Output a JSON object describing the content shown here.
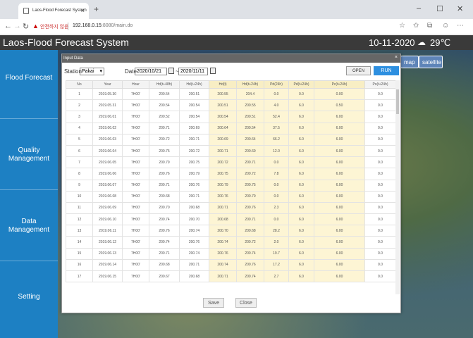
{
  "browser": {
    "tab_title": "Laos-Flood Forecast System",
    "tab_close": "×",
    "new_tab": "+",
    "security_label": "안전하지 않음",
    "url_host": "192.168.0.15",
    "url_rest": ":8080/main.do"
  },
  "app": {
    "title": "Laos-Flood Forecast System",
    "date": "10-11-2020",
    "temperature": "29℃",
    "weather_icon": "cloud-icon"
  },
  "map_buttons": {
    "map": "map",
    "satellite": "satellite"
  },
  "sidebar": {
    "items": [
      {
        "label": "Flood Forecast"
      },
      {
        "label": "Quality Management"
      },
      {
        "label": "Data Management"
      },
      {
        "label": "Setting"
      }
    ]
  },
  "modal": {
    "title": "Input Data",
    "close": "×",
    "station_label": "Station",
    "station_value": "Pakai",
    "date_label": "Date",
    "date_from": "2020/10/21",
    "date_separator": "~",
    "date_to": "2020/11/11",
    "open_button": "OPEN",
    "run_button": "RUN",
    "save_button": "Save",
    "close_button": "Close",
    "columns": [
      "No",
      "Year",
      "Hour",
      "Hd(t+48h)",
      "Hd(t+24h)",
      "Hd(t)",
      "Hd(t+24h)",
      "Pd(24h)",
      "Pd(t+24h)",
      "Pc(t+24h)",
      "Po(t+24h)"
    ],
    "rows": [
      [
        "1",
        "2019.05.30",
        "7H00'",
        "200.54",
        "200.51",
        "200.55",
        "204.4",
        "0.0",
        "0.0",
        "0.00",
        "0.0"
      ],
      [
        "2",
        "2019.05.31",
        "7H00'",
        "200.54",
        "200.54",
        "200.51",
        "200.55",
        "4.0",
        "6.0",
        "0.50",
        "0.0"
      ],
      [
        "3",
        "2019.06.01",
        "7H00'",
        "200.52",
        "200.54",
        "200.54",
        "200.51",
        "52.4",
        "6.0",
        "6.00",
        "0.0"
      ],
      [
        "4",
        "2019.06.02",
        "7H00'",
        "200.71",
        "200.69",
        "200.64",
        "200.54",
        "37.5",
        "6.0",
        "6.00",
        "0.0"
      ],
      [
        "5",
        "2019.06.03",
        "7H00'",
        "200.72",
        "200.71",
        "200.69",
        "200.64",
        "66.2",
        "6.0",
        "6.00",
        "0.0"
      ],
      [
        "6",
        "2019.06.04",
        "7H00'",
        "200.75",
        "200.72",
        "200.71",
        "200.69",
        "12.0",
        "6.0",
        "6.00",
        "0.0"
      ],
      [
        "7",
        "2019.06.05",
        "7H00'",
        "200.79",
        "200.75",
        "200.72",
        "200.71",
        "0.0",
        "6.0",
        "6.00",
        "0.0"
      ],
      [
        "8",
        "2019.06.06",
        "7H00'",
        "200.76",
        "200.79",
        "200.75",
        "200.72",
        "7.8",
        "6.0",
        "6.00",
        "0.0"
      ],
      [
        "9",
        "2019.06.07",
        "7H00'",
        "200.71",
        "200.76",
        "200.79",
        "200.75",
        "0.0",
        "6.0",
        "6.00",
        "0.0"
      ],
      [
        "10",
        "2019.06.08",
        "7H00'",
        "200.68",
        "200.71",
        "200.76",
        "200.79",
        "0.0",
        "6.0",
        "6.00",
        "0.0"
      ],
      [
        "11",
        "2019.06.09",
        "7H00'",
        "200.70",
        "200.68",
        "200.71",
        "200.76",
        "2.3",
        "6.0",
        "6.00",
        "0.0"
      ],
      [
        "12",
        "2019.06.10",
        "7H00'",
        "200.74",
        "200.70",
        "200.68",
        "200.71",
        "0.0",
        "6.0",
        "6.00",
        "0.0"
      ],
      [
        "13",
        "2019.06.11",
        "7H00'",
        "200.76",
        "200.74",
        "200.70",
        "200.68",
        "28.2",
        "6.0",
        "6.00",
        "0.0"
      ],
      [
        "14",
        "2019.06.12",
        "7H00'",
        "200.74",
        "200.76",
        "200.74",
        "200.72",
        "2.0",
        "6.0",
        "6.00",
        "0.0"
      ],
      [
        "15",
        "2019.06.13",
        "7H00'",
        "200.71",
        "200.74",
        "200.76",
        "200.74",
        "19.7",
        "6.0",
        "6.00",
        "0.0"
      ],
      [
        "16",
        "2019.06.14",
        "7H00'",
        "200.68",
        "200.71",
        "200.74",
        "200.76",
        "17.2",
        "6.0",
        "6.00",
        "0.0"
      ],
      [
        "17",
        "2019.06.15",
        "7H00'",
        "200.67",
        "200.68",
        "200.71",
        "200.74",
        "2.7",
        "6.0",
        "6.00",
        "0.0"
      ]
    ]
  }
}
